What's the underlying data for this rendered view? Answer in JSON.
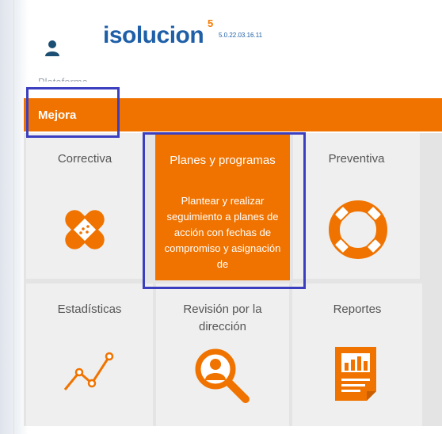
{
  "header": {
    "brand": "isolucion",
    "brand_sup": "5",
    "version": "5.0.22.03.16.11"
  },
  "nav": {
    "faded_item": "Plataforma"
  },
  "section": {
    "title": "Mejora"
  },
  "tiles": [
    {
      "label": "Correctiva",
      "icon": "bandage-icon"
    },
    {
      "label": "Planes y programas",
      "icon": "none",
      "description": "Plantear y realizar seguimiento a planes de acción con fechas de compromiso y asignación de"
    },
    {
      "label": "Preventiva",
      "icon": "lifebuoy-icon"
    },
    {
      "label": "Estadísticas",
      "icon": "line-chart-icon"
    },
    {
      "label": "Revisión por la dirección",
      "icon": "magnifier-person-icon"
    },
    {
      "label": "Reportes",
      "icon": "report-icon"
    }
  ],
  "colors": {
    "accent": "#f07300",
    "brand": "#1e5fa8",
    "highlight": "#3b3fbf"
  }
}
